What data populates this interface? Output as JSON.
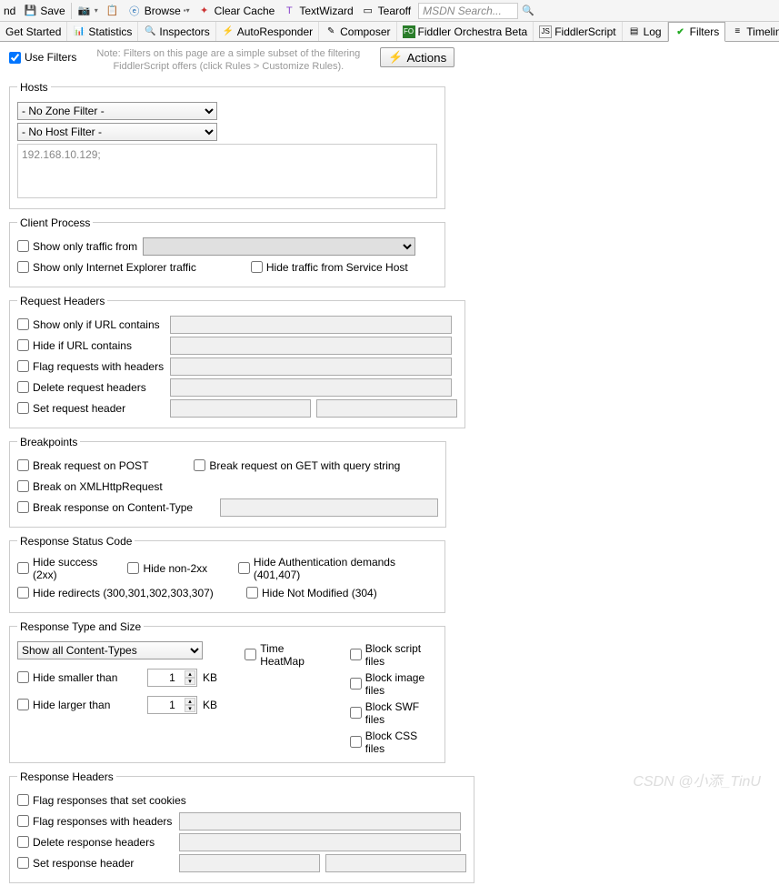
{
  "toolbar": {
    "replay_partial": "nd",
    "save": "Save",
    "browse": "Browse",
    "clear_cache": "Clear Cache",
    "textwizard": "TextWizard",
    "tearoff": "Tearoff",
    "search_placeholder": "MSDN Search..."
  },
  "tabs": {
    "get_started": "Get Started",
    "statistics": "Statistics",
    "inspectors": "Inspectors",
    "autoresponder": "AutoResponder",
    "composer": "Composer",
    "orchestra": "Fiddler Orchestra Beta",
    "fiddlerscript": "FiddlerScript",
    "log": "Log",
    "filters": "Filters",
    "timeline": "Timeline"
  },
  "filters": {
    "use_filters": "Use Filters",
    "note": "Note: Filters on this page are a simple subset of the filtering FiddlerScript offers (click Rules > Customize Rules).",
    "actions": "Actions"
  },
  "hosts": {
    "legend": "Hosts",
    "zone_filter": "- No Zone Filter -",
    "host_filter": "- No Host Filter -",
    "hosts_text": "192.168.10.129;"
  },
  "client_process": {
    "legend": "Client Process",
    "show_only_traffic": "Show only traffic from",
    "show_only_ie": "Show only Internet Explorer traffic",
    "hide_service_host": "Hide traffic from Service Host"
  },
  "request_headers": {
    "legend": "Request Headers",
    "show_url_contains": "Show only if URL contains",
    "hide_url_contains": "Hide if URL contains",
    "flag_requests": "Flag requests with headers",
    "delete_headers": "Delete request headers",
    "set_header": "Set request header"
  },
  "breakpoints": {
    "legend": "Breakpoints",
    "break_post": "Break request on POST",
    "break_get": "Break request on GET with query string",
    "break_xhr": "Break on XMLHttpRequest",
    "break_content_type": "Break response on Content-Type"
  },
  "status_code": {
    "legend": "Response Status Code",
    "hide_success": "Hide success (2xx)",
    "hide_non_2xx": "Hide non-2xx",
    "hide_auth": "Hide Authentication demands (401,407)",
    "hide_redirects": "Hide redirects (300,301,302,303,307)",
    "hide_not_modified": "Hide Not Modified (304)"
  },
  "type_size": {
    "legend": "Response Type and Size",
    "show_all": "Show all Content-Types",
    "hide_smaller": "Hide smaller than",
    "hide_larger": "Hide larger than",
    "kb": "KB",
    "smaller_val": "1",
    "larger_val": "1",
    "time_heatmap": "Time HeatMap",
    "block_script": "Block script files",
    "block_image": "Block image files",
    "block_swf": "Block SWF files",
    "block_css": "Block CSS files"
  },
  "response_headers": {
    "legend": "Response Headers",
    "flag_cookies": "Flag responses that set cookies",
    "flag_headers": "Flag responses with headers",
    "delete_headers": "Delete response headers",
    "set_header": "Set response header"
  },
  "watermark": "CSDN @小添_TinU"
}
